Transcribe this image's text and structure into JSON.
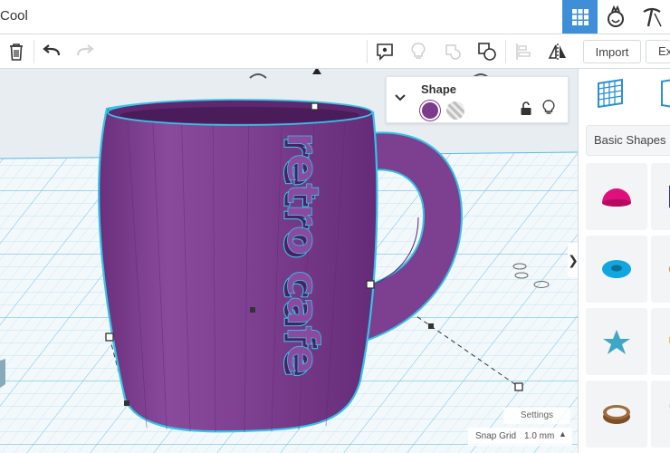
{
  "document": {
    "title": "Cool"
  },
  "topbar": {
    "icons": [
      {
        "name": "grid-view-icon",
        "active": true
      },
      {
        "name": "simulate-icon",
        "active": false
      },
      {
        "name": "minecraft-pickaxe-icon",
        "active": false
      }
    ]
  },
  "toolbar": {
    "left_tools": [
      "delete-icon",
      "undo-icon",
      "redo-icon"
    ],
    "right_tools": [
      "notes-icon",
      "light-bulb-icon",
      "group-icon",
      "ungroup-icon",
      "align-icon",
      "mirror-icon"
    ],
    "import_label": "Import",
    "export_label": "Export"
  },
  "inspector": {
    "title": "Shape",
    "solid_color": "#7b3c8c",
    "hole_pattern": "striped",
    "lock_icon": "unlock-icon",
    "visibility_icon": "light-bulb-icon"
  },
  "scene": {
    "object_text": "retro cafe",
    "object_color": "#7b3c8c",
    "highlight_color": "#33c3e6",
    "grid_color": "#5ab9e6"
  },
  "settings": {
    "label": "Settings",
    "snap_grid_label": "Snap Grid",
    "snap_grid_value": "1.0 mm"
  },
  "library": {
    "selected": "Basic Shapes",
    "shapes": [
      {
        "name": "half-sphere-shape",
        "color": "#e0107a"
      },
      {
        "name": "box-shape",
        "color": "#1e3c8c"
      },
      {
        "name": "torus-shape",
        "color": "#10a6e0"
      },
      {
        "name": "cone-shape",
        "color": "#ec8a1c"
      },
      {
        "name": "star-shape",
        "color": "#3fa7c4"
      },
      {
        "name": "text-shape",
        "color": "#f2c400"
      },
      {
        "name": "tube-shape",
        "color": "#a06c3c"
      },
      {
        "name": "paraboloid-shape",
        "color": "#c8c8c8"
      }
    ]
  }
}
